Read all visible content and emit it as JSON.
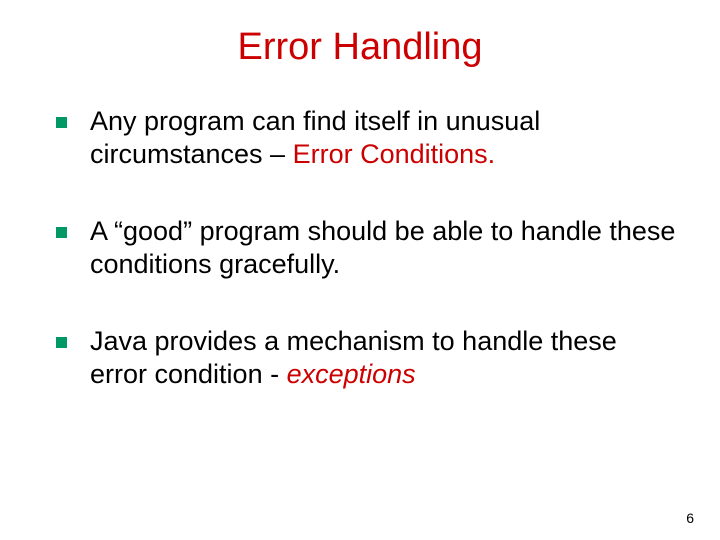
{
  "slide": {
    "title": "Error Handling",
    "bullets": [
      {
        "pre": "Any program can find itself in unusual circumstances – ",
        "em": "Error Conditions.",
        "post": ""
      },
      {
        "pre": "A “good” program should be able to handle these conditions gracefully.",
        "em": "",
        "post": ""
      },
      {
        "pre": "Java provides a mechanism to handle these error condition - ",
        "em": "",
        "italic": " exceptions",
        "post": ""
      }
    ],
    "page_number": "6"
  }
}
